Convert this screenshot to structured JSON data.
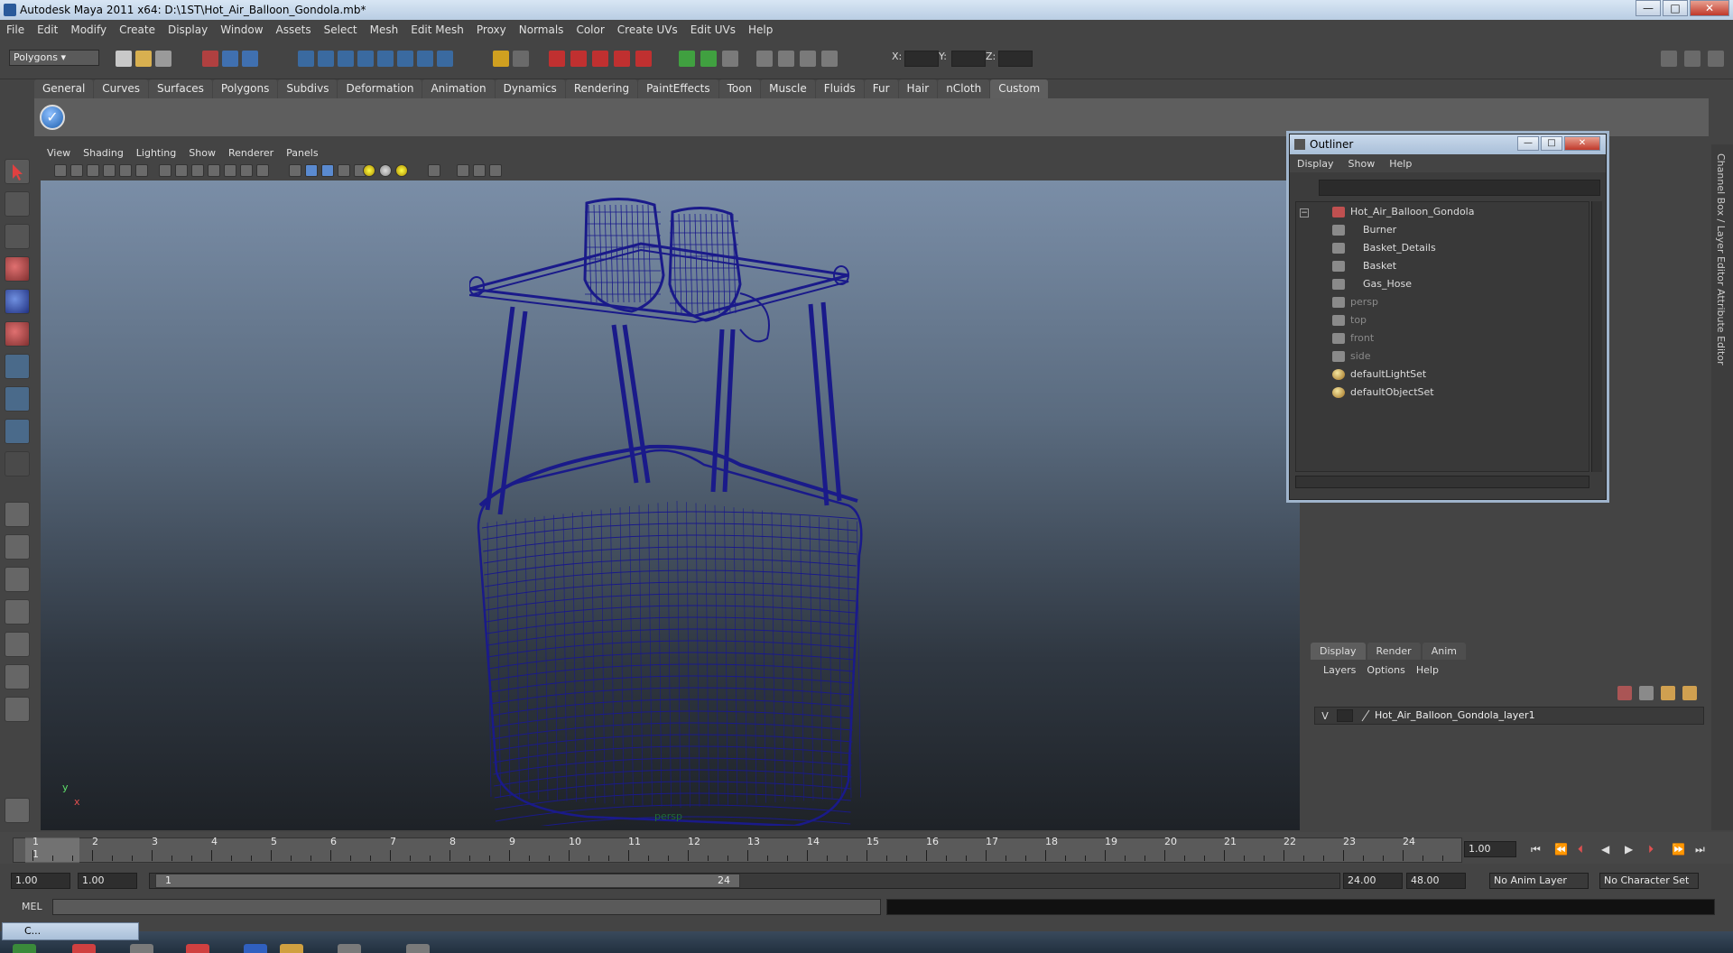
{
  "window": {
    "title": "Autodesk Maya 2011 x64: D:\\1ST\\Hot_Air_Balloon_Gondola.mb*",
    "minimize": "—",
    "maximize": "□",
    "close": "✕"
  },
  "menubar": [
    "File",
    "Edit",
    "Modify",
    "Create",
    "Display",
    "Window",
    "Assets",
    "Select",
    "Mesh",
    "Edit Mesh",
    "Proxy",
    "Normals",
    "Color",
    "Create UVs",
    "Edit UVs",
    "Help"
  ],
  "status_line": {
    "mode": "Polygons",
    "x_label": "X:",
    "y_label": "Y:",
    "z_label": "Z:"
  },
  "shelf_tabs": [
    "General",
    "Curves",
    "Surfaces",
    "Polygons",
    "Subdivs",
    "Deformation",
    "Animation",
    "Dynamics",
    "Rendering",
    "PaintEffects",
    "Toon",
    "Muscle",
    "Fluids",
    "Fur",
    "Hair",
    "nCloth",
    "Custom"
  ],
  "shelf_active_tab": "Custom",
  "viewport": {
    "menu": [
      "View",
      "Shading",
      "Lighting",
      "Show",
      "Renderer",
      "Panels"
    ],
    "camera_label": "persp",
    "axis_y": "y",
    "axis_x": "x",
    "wire_color": "#1a1a8a"
  },
  "outliner": {
    "title": "Outliner",
    "menu": [
      "Display",
      "Show",
      "Help"
    ],
    "root": "Hot_Air_Balloon_Gondola",
    "children": [
      "Burner",
      "Basket_Details",
      "Basket",
      "Gas_Hose"
    ],
    "cameras": [
      "persp",
      "top",
      "front",
      "side"
    ],
    "sets": [
      "defaultLightSet",
      "defaultObjectSet"
    ]
  },
  "layer_editor": {
    "tabs": [
      "Display",
      "Render",
      "Anim"
    ],
    "active_tab": "Display",
    "menu": [
      "Layers",
      "Options",
      "Help"
    ],
    "layer_visible": "V",
    "layer_name": "Hot_Air_Balloon_Gondola_layer1"
  },
  "side_tabs": [
    "Channel Box / Layer Editor",
    "Attribute Editor"
  ],
  "timeline": {
    "ticks": [
      "1",
      "2",
      "3",
      "4",
      "5",
      "6",
      "7",
      "8",
      "9",
      "10",
      "11",
      "12",
      "13",
      "14",
      "15",
      "16",
      "17",
      "18",
      "19",
      "20",
      "21",
      "22",
      "23",
      "24"
    ],
    "current_frame": "1",
    "current_time_field": "1.00"
  },
  "range": {
    "start": "1.00",
    "playback_start": "1.00",
    "slider_start": "1",
    "slider_end": "24",
    "playback_end": "24.00",
    "end": "48.00",
    "anim_layer": "No Anim Layer",
    "character_set": "No Character Set"
  },
  "command_line": {
    "label": "MEL"
  },
  "taskbar": {
    "minimized_window": "C..."
  }
}
